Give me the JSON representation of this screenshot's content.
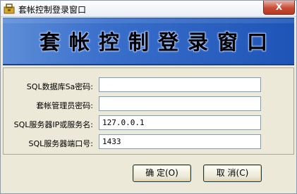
{
  "window": {
    "title": "套帐控制登录窗口",
    "close_label": "X"
  },
  "banner": {
    "text": "套帐控制登录窗口"
  },
  "form": {
    "sa_password": {
      "label": "SQL数据库Sa密码:",
      "value": ""
    },
    "admin_password": {
      "label": "套帐管理员密码:",
      "value": ""
    },
    "server_name": {
      "label": "SQL服务器IP或服务名:",
      "value": "127.0.0.1"
    },
    "server_port": {
      "label": "SQL服务器端口号:",
      "value": "1433"
    }
  },
  "buttons": {
    "ok_label": "确 定(O)",
    "cancel_label": "取 消(C)"
  },
  "colors": {
    "banner_accent": "#1e54b6",
    "close_button": "#c74a33"
  }
}
